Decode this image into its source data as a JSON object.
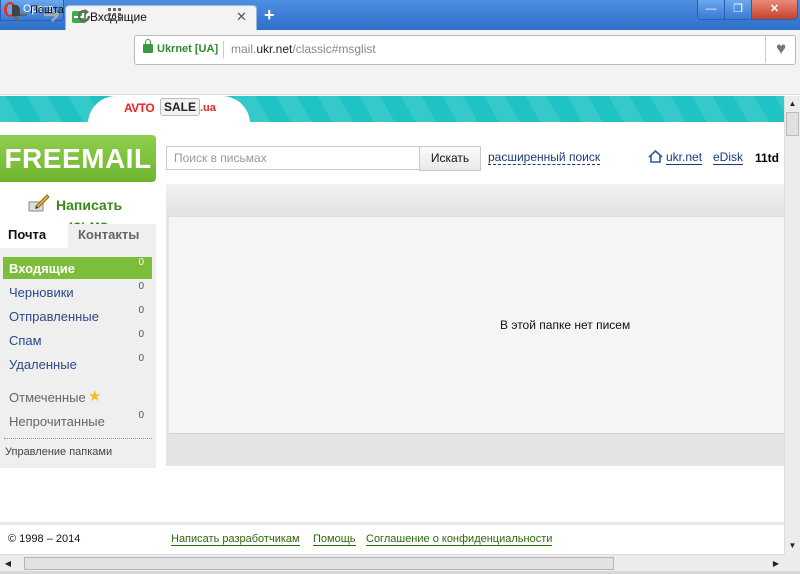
{
  "browser": {
    "menu_label": "Opera",
    "tab_title": "Входящие",
    "tab_close": "✕",
    "new_tab": "+",
    "window_buttons": {
      "minimize": "—",
      "maximize": "❐",
      "close": "✕"
    }
  },
  "addressbar": {
    "site_name": "Ukrnet [UA]",
    "url_prefix": "mail.",
    "url_host": "ukr.net",
    "url_path": "/classic#msglist"
  },
  "bookmarks": [
    {
      "label": "Пошта"
    }
  ],
  "banner": {
    "avto": "AVTO",
    "sale": "SALE",
    "ua": ".ua"
  },
  "logo": "FREEMAIL",
  "compose_label": "Написать письмо",
  "sidebar_tabs": {
    "mail": "Почта",
    "contacts": "Контакты"
  },
  "folders": [
    {
      "label": "Входящие",
      "count": "0"
    },
    {
      "label": "Черновики",
      "count": "0"
    },
    {
      "label": "Отправленные",
      "count": "0"
    },
    {
      "label": "Спам",
      "count": "0"
    },
    {
      "label": "Удаленные",
      "count": "0"
    }
  ],
  "extra_folders": [
    {
      "label": "Отмеченные",
      "count": ""
    },
    {
      "label": "Непрочитанные",
      "count": "0"
    }
  ],
  "manage_folders": "Управление папками",
  "search": {
    "placeholder": "Поиск в письмах",
    "button": "Искать",
    "advanced": "расширенный поиск"
  },
  "top_links": {
    "ukr": "ukr.net",
    "edisk": "eDisk",
    "user": "11td"
  },
  "empty_message": "В этой папке нет писем",
  "footer": {
    "copyright": "© 1998 – 2014",
    "links": [
      "Написать разработчикам",
      "Помощь",
      "Соглашение о конфиденциальности"
    ]
  },
  "scroll_arrows": {
    "up": "▲",
    "down": "▼",
    "left": "◀",
    "right": "▶"
  },
  "colors": {
    "accent": "#7cbd39",
    "banner": "#1fc3c3",
    "titlebar": "#3a7ad6"
  }
}
